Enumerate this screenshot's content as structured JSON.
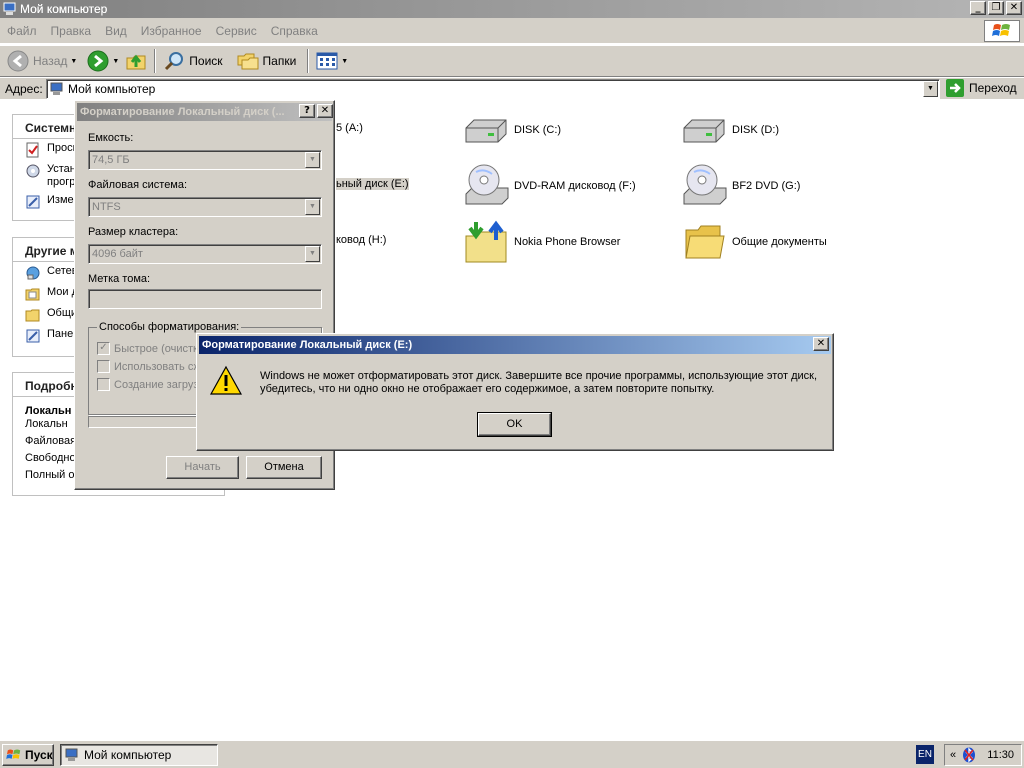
{
  "window": {
    "title": "Мой компьютер"
  },
  "menu": [
    "Файл",
    "Правка",
    "Вид",
    "Избранное",
    "Сервис",
    "Справка"
  ],
  "toolbar": {
    "back": "Назад",
    "search": "Поиск",
    "folders": "Папки"
  },
  "address": {
    "label": "Адрес:",
    "value": "Мой компьютер",
    "go": "Переход"
  },
  "taskpane": {
    "system": {
      "title": "Системн",
      "items": [
        "Просм",
        "Устан\nпрогр",
        "Измен"
      ]
    },
    "other": {
      "title": "Другие м",
      "items": [
        "Сетев",
        "Мои д",
        "Общи",
        "Пане"
      ]
    },
    "details": {
      "title": "Подробн",
      "name": "Локальн",
      "lines": [
        "Локальн",
        "Файловая",
        "Свободно",
        "Полный о"
      ]
    }
  },
  "drives": [
    {
      "name": "5 (A:)",
      "icon": "floppy-icon"
    },
    {
      "name": "DISK (C:)",
      "icon": "hard-disk-icon"
    },
    {
      "name": "DISK (D:)",
      "icon": "hard-disk-icon"
    },
    {
      "name": "ьный диск (E:)",
      "icon": "hard-disk-icon"
    },
    {
      "name": "DVD-RAM дисковод (F:)",
      "icon": "dvd-drive-icon"
    },
    {
      "name": "BF2 DVD (G:)",
      "icon": "dvd-drive-icon"
    },
    {
      "name": "ковод (H:)",
      "icon": "cd-drive-icon"
    },
    {
      "name": "Nokia Phone Browser",
      "icon": "nokia-phone-browser-icon"
    },
    {
      "name": "Общие документы",
      "icon": "folder-icon"
    }
  ],
  "format_dialog": {
    "title": "Форматирование Локальный диск (...",
    "capacity_label": "Емкость:",
    "capacity_value": "74,5 ГБ",
    "fs_label": "Файловая система:",
    "fs_value": "NTFS",
    "cluster_label": "Размер кластера:",
    "cluster_value": "4096 байт",
    "volume_label": "Метка тома:",
    "options_label": "Способы форматирования:",
    "options": [
      "Быстрое (очистк",
      "Использовать сж",
      "Создание загруз"
    ],
    "start": "Начать",
    "cancel": "Отмена"
  },
  "error_dialog": {
    "title": "Форматирование Локальный диск (E:)",
    "message": "Windows не может отформатировать этот диск. Завершите все прочие программы, использующие этот диск, убедитесь, что ни одно окно не отображает его содержимое, а затем повторите попытку.",
    "ok": "OK"
  },
  "taskbar": {
    "start": "Пуск",
    "task": "Мой компьютер",
    "lang": "EN",
    "tray_chevron": "«",
    "time": "11:30"
  }
}
